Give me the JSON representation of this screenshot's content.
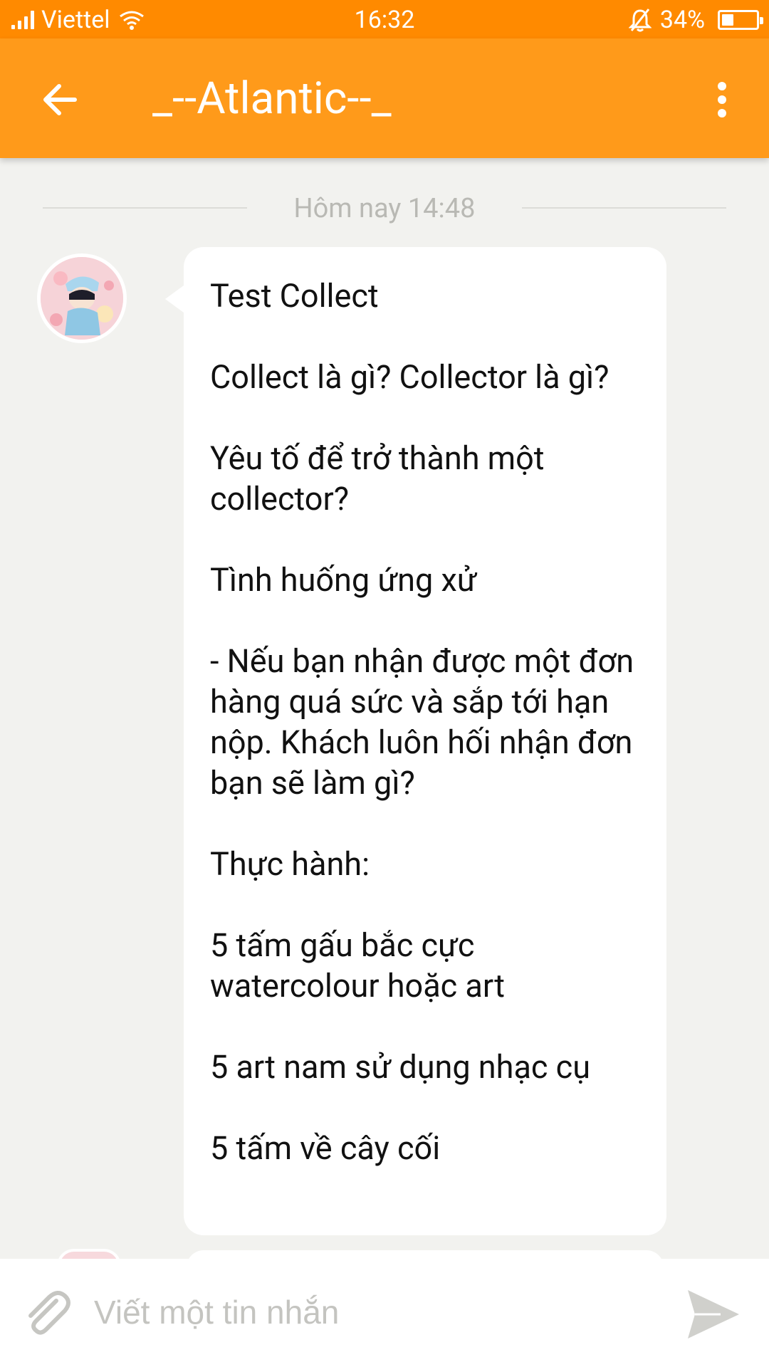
{
  "status_bar": {
    "carrier": "Viettel",
    "time": "16:32",
    "battery": "34%",
    "battery_level": 0.34,
    "icons": [
      "signal-icon",
      "wifi-icon",
      "bell-off-icon",
      "battery-icon"
    ]
  },
  "header": {
    "title": "_--Atlantic--_",
    "icons": [
      "back-arrow-icon",
      "more-vertical-icon"
    ]
  },
  "conversation": {
    "date_divider": "Hôm nay 14:48",
    "messages": [
      {
        "paragraphs": [
          "Test Collect",
          "Collect là gì? Collector là gì?",
          "Yêu tố để trở thành một collector?",
          "Tình huống ứng xử",
          "- Nếu bạn nhận được một đơn hàng quá sức và sắp tới hạn nộp. Khách luôn hối nhận đơn bạn sẽ làm gì?",
          "Thực hành:",
          "5 tấm gấu bắc cực watercolour hoặc art",
          "5 art nam sử dụng nhạc cụ",
          "5 tấm về cây cối"
        ]
      }
    ]
  },
  "composer": {
    "placeholder": "Viết một tin nhắn",
    "value": "",
    "icons": [
      "paperclip-icon",
      "send-icon"
    ]
  },
  "colors": {
    "status_bar": "#ff8a00",
    "app_bar": "#ff9a1a",
    "background": "#f2f2ef"
  }
}
